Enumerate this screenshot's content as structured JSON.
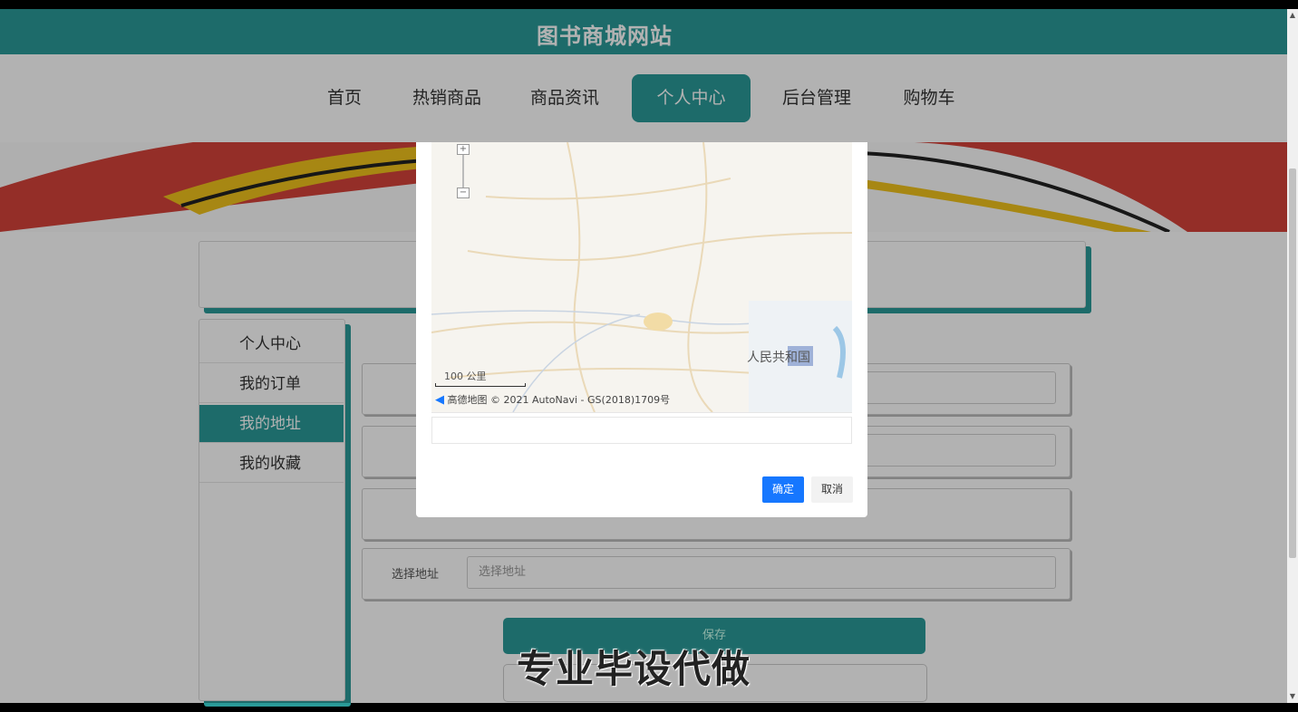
{
  "header": {
    "title": "图书商城网站"
  },
  "nav": {
    "items": [
      {
        "label": "首页"
      },
      {
        "label": "热销商品"
      },
      {
        "label": "商品资讯"
      },
      {
        "label": "个人中心"
      },
      {
        "label": "后台管理"
      },
      {
        "label": "购物车"
      }
    ],
    "active": "个人中心"
  },
  "sidebar": {
    "items": [
      {
        "label": "个人中心"
      },
      {
        "label": "我的订单"
      },
      {
        "label": "我的地址"
      },
      {
        "label": "我的收藏"
      }
    ],
    "active": "我的地址"
  },
  "form": {
    "address_label": "选择地址",
    "address_placeholder": "选择地址",
    "save_label": "保存"
  },
  "map_modal": {
    "scale_label": "100 公里",
    "provider": "高德地图",
    "copyright": "© 2021 AutoNavi - GS(2018)1709号",
    "place_label": "人民共和国",
    "ok_label": "确定",
    "cancel_label": "取消"
  },
  "watermark": {
    "text": "专业毕设代做"
  },
  "colors": {
    "accent": "#2a9a98",
    "primary_button": "#1677ff"
  }
}
